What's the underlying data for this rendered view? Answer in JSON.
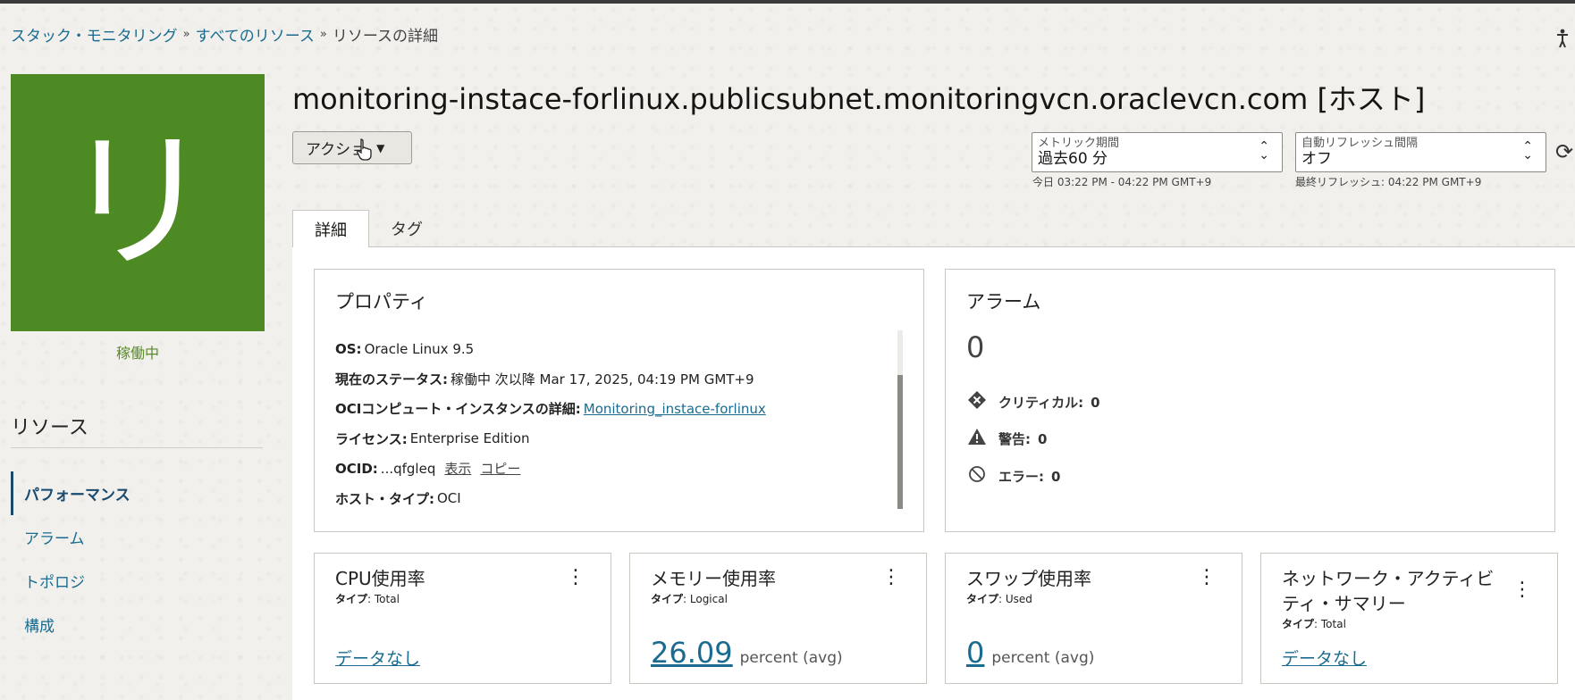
{
  "breadcrumb": {
    "items": [
      "スタック・モニタリング",
      "すべてのリソース"
    ],
    "current": "リソースの詳細",
    "separator": "»"
  },
  "resource": {
    "avatar_letter": "リ",
    "avatar_color": "#4e8a24",
    "status": "稼働中",
    "title": "monitoring-instace-forlinux.publicsubnet.monitoringvcn.oraclevcn.com [ホスト]"
  },
  "sidebar": {
    "heading": "リソース",
    "items": [
      {
        "label": "パフォーマンス",
        "active": true
      },
      {
        "label": "アラーム"
      },
      {
        "label": "トポロジ"
      },
      {
        "label": "構成"
      }
    ]
  },
  "toolbar": {
    "action_label": "アクショ",
    "metric_period_label": "メトリック期間",
    "metric_period_value": "過去60 分",
    "metric_period_hint": "今日 03:22 PM - 04:22 PM GMT+9",
    "refresh_label": "自動リフレッシュ間隔",
    "refresh_value": "オフ",
    "refresh_hint": "最終リフレッシュ: 04:22 PM GMT+9"
  },
  "tabs": [
    {
      "label": "詳細",
      "active": true
    },
    {
      "label": "タグ"
    }
  ],
  "properties": {
    "title": "プロパティ",
    "os_key": "OS:",
    "os_val": "Oracle Linux 9.5",
    "status_key": "現在のステータス:",
    "status_val": "稼働中 次以降 Mar 17, 2025, 04:19 PM GMT+9",
    "oci_key": "OCIコンピュート・インスタンスの詳細:",
    "oci_link": "Monitoring_instace-forlinux",
    "license_key": "ライセンス:",
    "license_val": "Enterprise Edition",
    "ocid_key": "OCID:",
    "ocid_val": "...qfgleq",
    "ocid_show": "表示",
    "ocid_copy": "コピー",
    "host_type_key": "ホスト・タイプ:",
    "host_type_val": "OCI"
  },
  "alarms": {
    "title": "アラーム",
    "count": "0",
    "critical_label": "クリティカル:",
    "critical_count": "0",
    "warning_label": "警告:",
    "warning_count": "0",
    "error_label": "エラー:",
    "error_count": "0"
  },
  "metrics": [
    {
      "title": "CPU使用率",
      "type_key": "タイプ",
      "type_val": ": Total",
      "nodata": "データなし"
    },
    {
      "title": "メモリー使用率",
      "type_key": "タイプ",
      "type_val": ": Logical",
      "value": "26.09",
      "unit": "percent (avg)"
    },
    {
      "title": "スワップ使用率",
      "type_key": "タイプ",
      "type_val": ": Used",
      "value": "0",
      "unit": "percent (avg)"
    },
    {
      "title": "ネットワーク・アクティビティ・サマリー",
      "type_key": "タイプ",
      "type_val": ": Total",
      "nodata": "データなし"
    }
  ],
  "icons": {
    "accessibility": "accessibility-icon",
    "refresh": "refresh-icon",
    "critical": "critical-diamond-icon",
    "warning": "warning-triangle-icon",
    "error": "error-circle-icon",
    "kebab": "kebab-menu-icon"
  }
}
